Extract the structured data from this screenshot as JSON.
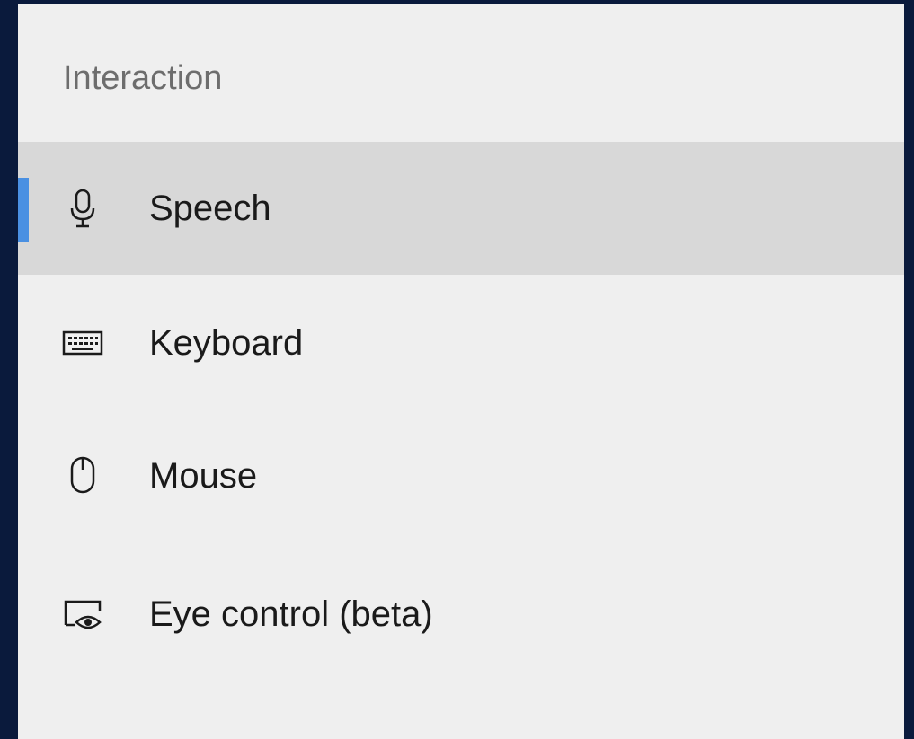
{
  "section": {
    "header": "Interaction"
  },
  "nav": {
    "items": [
      {
        "label": "Speech",
        "icon": "microphone-icon",
        "selected": true
      },
      {
        "label": "Keyboard",
        "icon": "keyboard-icon",
        "selected": false
      },
      {
        "label": "Mouse",
        "icon": "mouse-icon",
        "selected": false
      },
      {
        "label": "Eye control (beta)",
        "icon": "eye-control-icon",
        "selected": false
      }
    ]
  },
  "colors": {
    "accent": "#4a90e2",
    "panel_bg": "#efefef",
    "selected_bg": "#d8d8d8",
    "frame_bg": "#0a1a3c"
  }
}
